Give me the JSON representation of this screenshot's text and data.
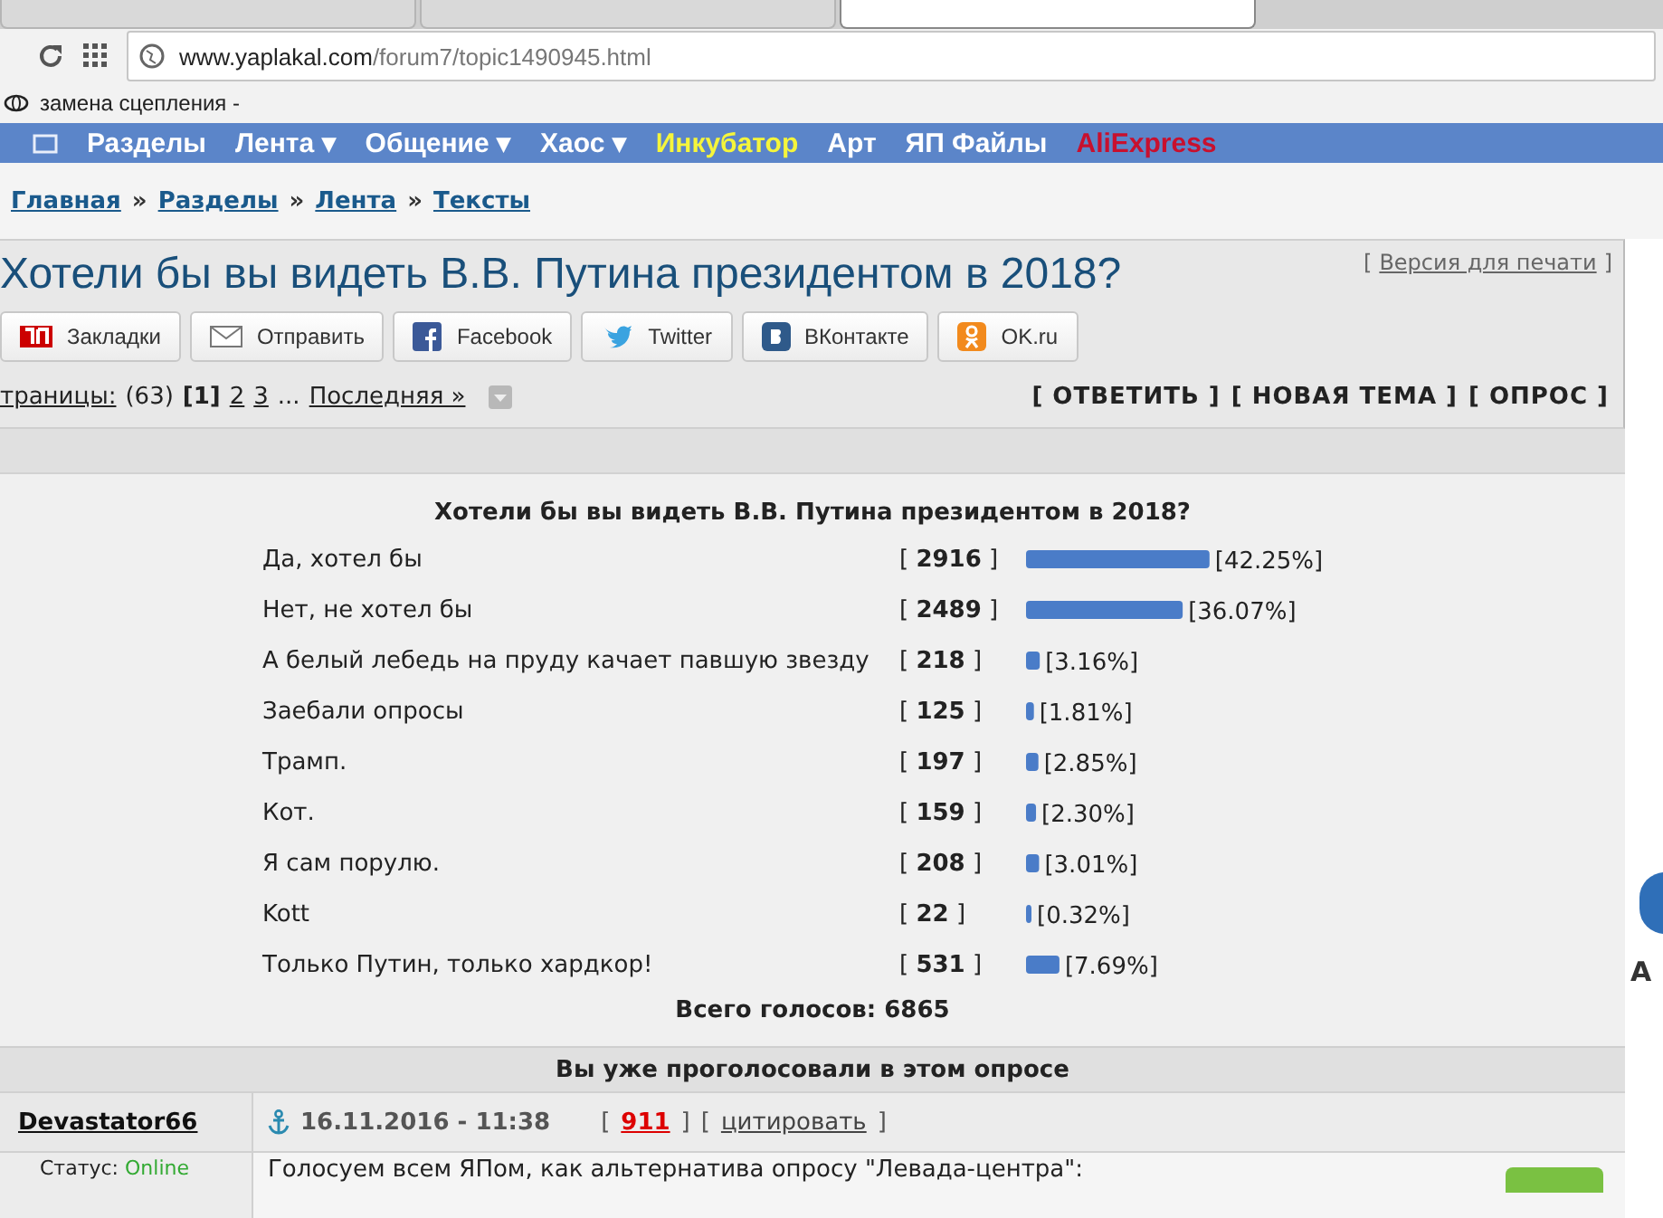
{
  "browser": {
    "tabs": [
      {
        "selected": false
      },
      {
        "selected": false
      },
      {
        "selected": true
      }
    ],
    "url_host": "www.yaplakal.com",
    "url_path": "/forum7/topic1490945.html",
    "bookmark": "замена сцепления -"
  },
  "nav": {
    "items": [
      {
        "label": "Разделы",
        "kind": "plain"
      },
      {
        "label": "Лента ▾",
        "kind": "plain"
      },
      {
        "label": "Общение ▾",
        "kind": "plain"
      },
      {
        "label": "Хаос ▾",
        "kind": "plain"
      },
      {
        "label": "Инкубатор",
        "kind": "highlight"
      },
      {
        "label": "Арт",
        "kind": "plain"
      },
      {
        "label": "ЯП Файлы",
        "kind": "plain"
      },
      {
        "label": "AliExpress",
        "kind": "promo"
      }
    ]
  },
  "breadcrumbs": {
    "separator": "»",
    "items": [
      "Главная",
      "Разделы",
      "Лента",
      "Тексты"
    ]
  },
  "topic": {
    "title": "Хотели бы вы видеть В.В. Путина президентом в 2018?",
    "print_link": {
      "open": "[",
      "label": "Версия для печати",
      "close": "]"
    },
    "share": [
      {
        "label": "Закладки",
        "kind": "yap"
      },
      {
        "label": "Отправить",
        "kind": "mail"
      },
      {
        "label": "Facebook",
        "kind": "facebook"
      },
      {
        "label": "Twitter",
        "kind": "twitter"
      },
      {
        "label": "ВКонтакте",
        "kind": "vk"
      },
      {
        "label": "OK.ru",
        "kind": "ok"
      }
    ],
    "pages": {
      "label": "траницы:",
      "count": "(63)",
      "items": [
        {
          "label": "[1]",
          "selected": true
        },
        {
          "label": "2",
          "selected": false
        },
        {
          "label": "3",
          "selected": false
        }
      ],
      "ellipsis": "...",
      "last": "Последняя »"
    },
    "actions": [
      "[ ОТВЕТИТЬ ]",
      "[ НОВАЯ ТЕМА ]",
      "[ ОПРОС ]"
    ]
  },
  "poll": {
    "question": "Хотели бы вы видеть В.В. Путина президентом в 2018?",
    "votes": [
      "[ **2916** ]",
      "[ **2489** ]",
      "[ **218** ]",
      "[ **125** ]",
      "[ **197** ]",
      "[ **159** ]",
      "[ **208** ]",
      "[ **22** ]",
      "[ **531** ]"
    ],
    "chart_data": {
      "type": "bar",
      "orientation": "horizontal",
      "categories": [
        "Да, хотел бы",
        "Нет, не хотел бы",
        "А белый лебедь на пруду качает павшую звезду",
        "Заебали опросы",
        "Трамп.",
        "Кот.",
        "Я сам порулю.",
        "Kott",
        "Только Путин, только хардкор!"
      ],
      "values": [
        42.25,
        36.07,
        3.16,
        1.81,
        2.85,
        2.3,
        3.01,
        0.32,
        7.69
      ],
      "value_labels": [
        "[42.25%]",
        "[36.07%]",
        "[3.16%]",
        "[1.81%]",
        "[2.85%]",
        "[2.30%]",
        "[3.01%]",
        "[0.32%]",
        "[7.69%]"
      ]
    },
    "total": "Всего голосов: 6865",
    "voted_notice": "Вы уже проголосовали в этом опросе"
  },
  "post": {
    "author": "Devastator66",
    "date": "16.11.2016 - 11:38",
    "meta": [
      {
        "text": "[",
        "kind": "bracket"
      },
      {
        "text": "911",
        "kind": "rating"
      },
      {
        "text": "]",
        "kind": "bracket"
      },
      {
        "text": "[",
        "kind": "bracket"
      },
      {
        "text": "цитировать",
        "kind": "quote"
      },
      {
        "text": "]",
        "kind": "bracket"
      }
    ],
    "status_label": "Статус:",
    "status": "Online",
    "text": "Голосуем всем ЯПом, как альтернатива опросу \"Левада-центра\":"
  },
  "side_letter": "A"
}
